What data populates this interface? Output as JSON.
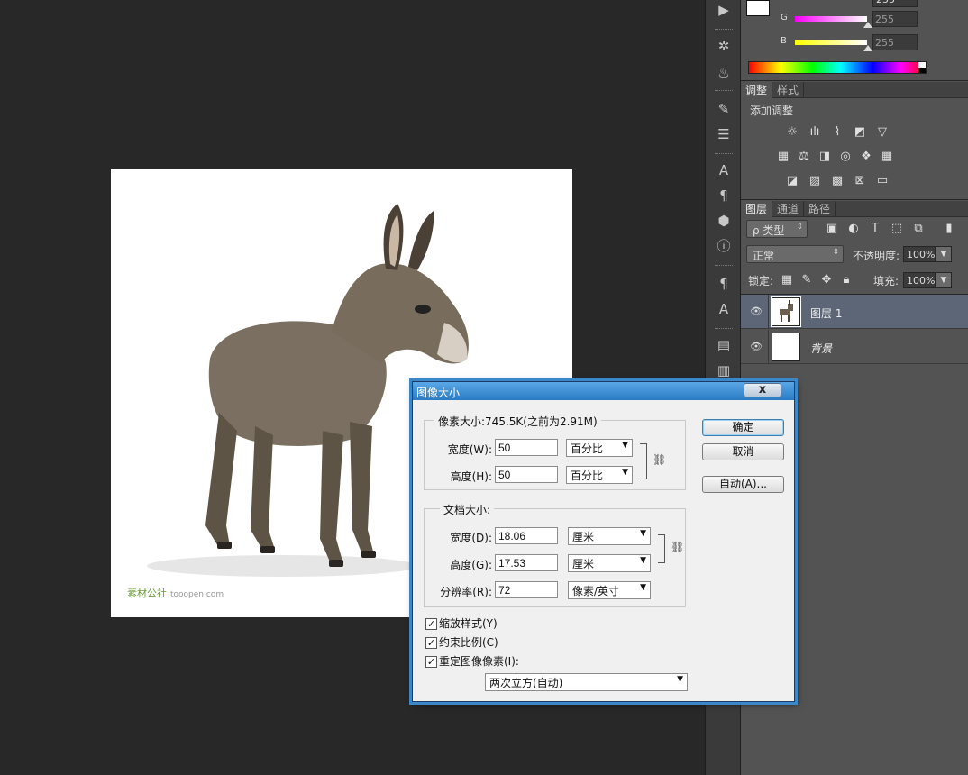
{
  "color_panel": {
    "channels": [
      {
        "label": "G",
        "value": "255",
        "bar_color": "#ff00ff"
      },
      {
        "label": "B",
        "value": "255",
        "bar_color": "#ffff00"
      }
    ],
    "partial_value": "255"
  },
  "adjust_panel": {
    "tabs": [
      "调整",
      "样式"
    ],
    "add_label": "添加调整"
  },
  "layers_panel": {
    "tabs": [
      "图层",
      "通道",
      "路径"
    ],
    "filter_kind": "ρ 类型",
    "blend_mode": "正常",
    "opacity_label": "不透明度:",
    "opacity_value": "100%",
    "lock_label": "锁定:",
    "fill_label": "填充:",
    "fill_value": "100%",
    "layers": [
      {
        "name": "图层 1",
        "selected": true
      },
      {
        "name": "背景",
        "selected": false
      }
    ]
  },
  "watermark": {
    "text": "素材公社",
    "sub": "tooopen.com"
  },
  "dialog": {
    "title": "图像大小",
    "close": "x",
    "pixel_group": {
      "title": "像素大小:745.5K(之前为2.91M)",
      "width_label": "宽度(W):",
      "width_value": "50",
      "width_unit": "百分比",
      "height_label": "高度(H):",
      "height_value": "50",
      "height_unit": "百分比"
    },
    "doc_group": {
      "title": "文档大小:",
      "width_label": "宽度(D):",
      "width_value": "18.06",
      "width_unit": "厘米",
      "height_label": "高度(G):",
      "height_value": "17.53",
      "height_unit": "厘米",
      "res_label": "分辨率(R):",
      "res_value": "72",
      "res_unit": "像素/英寸"
    },
    "checks": [
      {
        "label": "缩放样式(Y)",
        "checked": true
      },
      {
        "label": "约束比例(C)",
        "checked": true
      },
      {
        "label": "重定图像像素(I):",
        "checked": true
      }
    ],
    "resample_method": "两次立方(自动)",
    "buttons": {
      "ok": "确定",
      "cancel": "取消",
      "auto": "自动(A)..."
    }
  }
}
